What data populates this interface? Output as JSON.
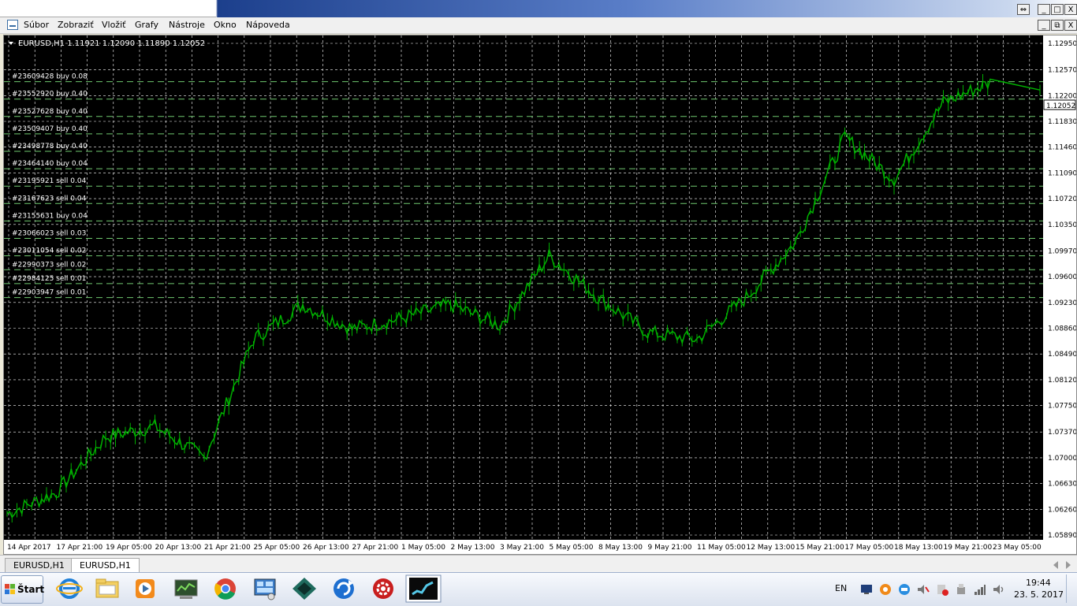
{
  "window": {
    "minimize_symbol": "_",
    "maximize_symbol": "□",
    "close_symbol": "X",
    "restore_symbol": "⧉",
    "resize_symbol": "⇔"
  },
  "menu": {
    "items": [
      "Súbor",
      "Zobraziť",
      "Vložiť",
      "Grafy",
      "Nástroje",
      "Okno",
      "Nápoveda"
    ]
  },
  "chart": {
    "header": "EURUSD,H1  1.11921 1.12090 1.11890 1.12052",
    "current_price_label": "1.12052",
    "colors": {
      "background": "#000000",
      "candles": "#00b000",
      "grid": "#ffffff",
      "orders": "#6fc86f",
      "axis_text": "#000000"
    },
    "orders": [
      "#23609428 buy 0.08",
      "#23552920 buy 0.40",
      "#23527628 buy 0.40",
      "#23509407 buy 0.40",
      "#23498778 buy 0.40",
      "#23464140 buy 0.04",
      "#23195921 sell 0.04",
      "#23167623 sell 0.04",
      "#23155631 buy 0.04",
      "#23066023 sell 0.03",
      "#23011054 sell 0.02",
      "#22990373 sell 0.02",
      "#22984125 sell 0.01",
      "#22903947 sell 0.01"
    ],
    "order_prices": [
      1.124,
      1.1215,
      1.119,
      1.1165,
      1.114,
      1.1115,
      1.109,
      1.1065,
      1.104,
      1.1015,
      1.099,
      1.097,
      1.095,
      1.093
    ],
    "price_ticks": [
      "1.12950",
      "1.12570",
      "1.12200",
      "1.11830",
      "1.11460",
      "1.11090",
      "1.10720",
      "1.10350",
      "1.09970",
      "1.09600",
      "1.09230",
      "1.08860",
      "1.08490",
      "1.08120",
      "1.07750",
      "1.07370",
      "1.07000",
      "1.06630",
      "1.06260",
      "1.05890"
    ],
    "time_ticks": [
      "14 Apr 2017",
      "17 Apr 21:00",
      "19 Apr 05:00",
      "20 Apr 13:00",
      "21 Apr 21:00",
      "25 Apr 05:00",
      "26 Apr 13:00",
      "27 Apr 21:00",
      "1 May 05:00",
      "2 May 13:00",
      "3 May 21:00",
      "5 May 05:00",
      "8 May 13:00",
      "9 May 21:00",
      "11 May 05:00",
      "12 May 13:00",
      "15 May 21:00",
      "17 May 05:00",
      "18 May 13:00",
      "19 May 21:00",
      "23 May 05:00"
    ]
  },
  "chart_data": {
    "type": "line",
    "title": "EURUSD,H1",
    "series": [
      {
        "name": "EURUSD,H1",
        "x": [
          "14 Apr 2017",
          "17 Apr 21:00",
          "19 Apr 05:00",
          "20 Apr 13:00",
          "21 Apr 21:00",
          "25 Apr 05:00",
          "26 Apr 13:00",
          "27 Apr 21:00",
          "1 May 05:00",
          "2 May 13:00",
          "3 May 21:00",
          "5 May 05:00",
          "8 May 13:00",
          "9 May 21:00",
          "11 May 05:00",
          "12 May 13:00",
          "15 May 21:00",
          "17 May 05:00",
          "18 May 13:00",
          "19 May 21:00",
          "23 May 05:00"
        ],
        "values": [
          1.062,
          1.065,
          1.073,
          1.0745,
          1.07,
          1.087,
          1.092,
          1.0885,
          1.09,
          1.092,
          1.089,
          1.099,
          1.093,
          1.088,
          1.087,
          1.093,
          1.101,
          1.116,
          1.11,
          1.121,
          1.124
        ]
      }
    ],
    "ylim": [
      1.0589,
      1.1295
    ],
    "grid": true
  },
  "tabs": [
    "EURUSD,H1",
    "EURUSD,H1"
  ],
  "taskbar": {
    "start_label": "Štart",
    "language": "EN",
    "time": "19:44",
    "date": "23. 5. 2017",
    "apps": [
      "internet-explorer-icon",
      "file-explorer-icon",
      "media-player-icon",
      "terminal-icon",
      "chrome-icon",
      "network-icon",
      "trading-app-icon",
      "refresh-app-icon",
      "gear-app-icon",
      "chart-app-icon"
    ]
  }
}
